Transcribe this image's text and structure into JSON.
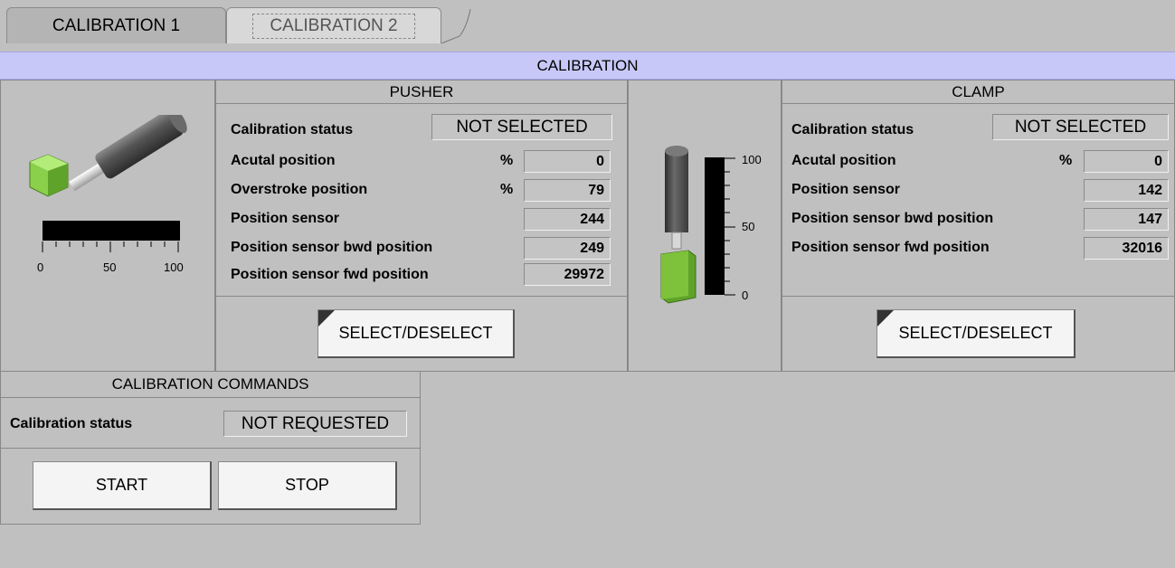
{
  "tabs": [
    {
      "label": "CALIBRATION 1"
    },
    {
      "label": "CALIBRATION 2"
    }
  ],
  "banner": {
    "title": "CALIBRATION"
  },
  "pusher": {
    "title": "PUSHER",
    "status_label": "Calibration status",
    "status_value": "NOT SELECTED",
    "rows": [
      {
        "label": "Acutal position",
        "unit": "%",
        "value": "0"
      },
      {
        "label": "Overstroke position",
        "unit": "%",
        "value": "79"
      },
      {
        "label": "Position sensor",
        "unit": "",
        "value": "244"
      },
      {
        "label": "Position sensor bwd position",
        "unit": "",
        "value": "249"
      },
      {
        "label": "Position sensor fwd position",
        "unit": "",
        "value": "29972"
      }
    ],
    "select_button": "SELECT/DESELECT"
  },
  "clamp": {
    "title": "CLAMP",
    "status_label": "Calibration status",
    "status_value": "NOT SELECTED",
    "rows": [
      {
        "label": "Acutal position",
        "unit": "%",
        "value": "0"
      },
      {
        "label": "Position sensor",
        "unit": "",
        "value": "142"
      },
      {
        "label": "Position sensor bwd position",
        "unit": "",
        "value": "147"
      },
      {
        "label": "Position sensor fwd position",
        "unit": "",
        "value": "32016"
      }
    ],
    "select_button": "SELECT/DESELECT"
  },
  "pusher_scale": {
    "ticks": [
      "0",
      "50",
      "100"
    ],
    "level": 0
  },
  "clamp_scale": {
    "ticks": [
      "100",
      "50",
      "0"
    ],
    "level": 0
  },
  "commands": {
    "title": "CALIBRATION COMMANDS",
    "status_label": "Calibration status",
    "status_value": "NOT REQUESTED",
    "start_label": "START",
    "stop_label": "STOP"
  },
  "colors": {
    "banner": "#c8c8f8",
    "green": "#7dc23a",
    "cylinder": "#505050"
  },
  "icons": [
    "pusher-cylinder-icon",
    "clamp-cylinder-icon"
  ]
}
